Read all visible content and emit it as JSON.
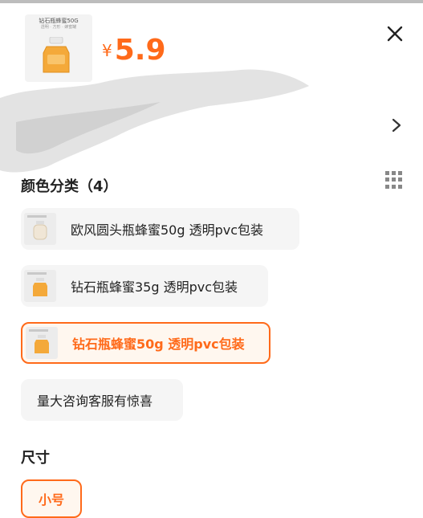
{
  "product": {
    "thumb_title": "钻石瓶蜂蜜50G",
    "thumb_subtitle": "透明 · 方形 · 蜂蜜罐",
    "currency": "¥",
    "price": "5.9"
  },
  "colors": {
    "accent": "#ff6a1a",
    "honey": "#f4a93a",
    "option_bg": "#f5f5f5"
  },
  "icons": {
    "close": "close-icon",
    "next": "chevron-right-icon",
    "grid": "grid-view-icon"
  },
  "color_section": {
    "title": "颜色分类（4）",
    "options": [
      {
        "label": "欧风圆头瓶蜂蜜50g 透明pvc包装",
        "selected": false
      },
      {
        "label": "钻石瓶蜂蜜35g 透明pvc包装",
        "selected": false
      },
      {
        "label": "钻石瓶蜂蜜50g 透明pvc包装",
        "selected": true
      },
      {
        "label": "量大咨询客服有惊喜",
        "selected": false
      }
    ]
  },
  "size_section": {
    "title": "尺寸",
    "options": [
      {
        "label": "小号",
        "selected": true
      }
    ]
  }
}
